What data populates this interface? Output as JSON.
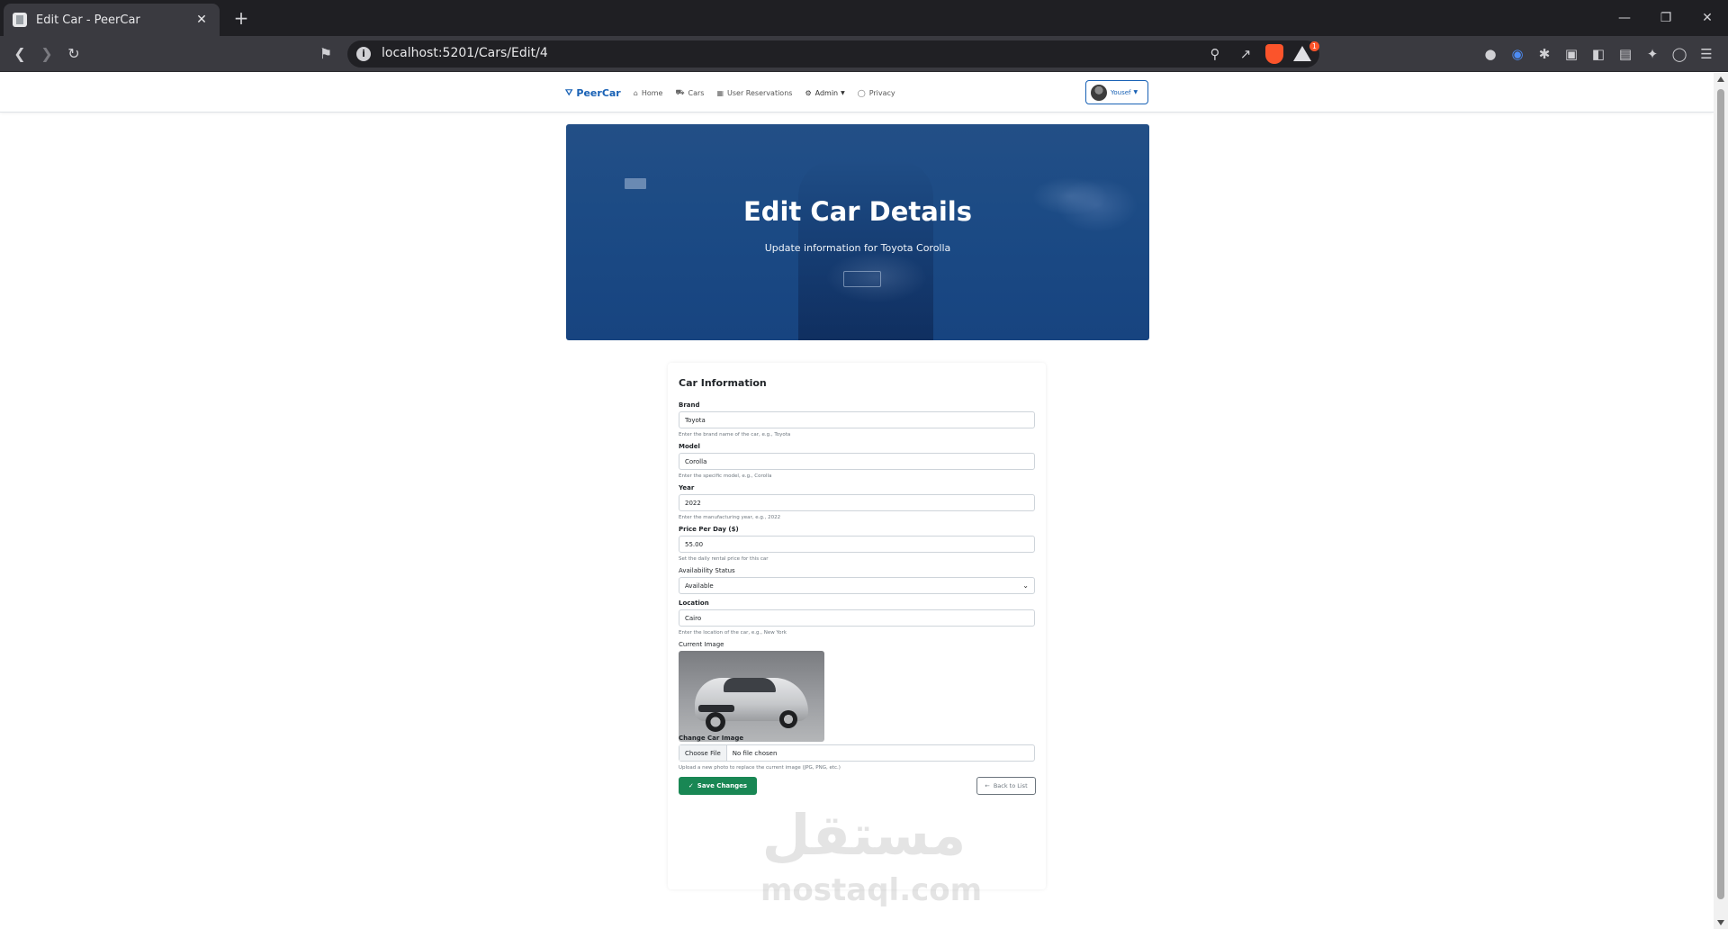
{
  "browser": {
    "tab_title": "Edit Car - PeerCar",
    "tab_close": "✕",
    "new_tab": "+",
    "url": "localhost:5201/Cars/Edit/4",
    "rewards_badge": "1"
  },
  "nav": {
    "brand": "PeerCar",
    "links": {
      "home": "Home",
      "cars": "Cars",
      "reservations": "User Reservations",
      "admin": "Admin",
      "privacy": "Privacy"
    },
    "user": "Yousef"
  },
  "hero": {
    "title": "Edit Car Details",
    "subtitle": "Update information for Toyota Corolla"
  },
  "form": {
    "title": "Car Information",
    "brand": {
      "label": "Brand",
      "value": "Toyota",
      "help": "Enter the brand name of the car, e.g., Toyota"
    },
    "model": {
      "label": "Model",
      "value": "Corolla",
      "help": "Enter the specific model, e.g., Corolla"
    },
    "year": {
      "label": "Year",
      "value": "2022",
      "help": "Enter the manufacturing year, e.g., 2022"
    },
    "price": {
      "label": "Price Per Day ($)",
      "value": "55.00",
      "help": "Set the daily rental price for this car"
    },
    "availability": {
      "label": "Availability Status",
      "value": "Available"
    },
    "location": {
      "label": "Location",
      "value": "Cairo",
      "help": "Enter the location of the car, e.g., New York"
    },
    "current_image_label": "Current Image",
    "change_image": {
      "label": "Change Car Image",
      "button": "Choose File",
      "status": "No file chosen",
      "help": "Upload a new photo to replace the current image (JPG, PNG, etc.)"
    },
    "save_button": "Save Changes",
    "back_button": "Back to List"
  },
  "watermark": {
    "arabic": "مستقل",
    "latin": "mostaql.com"
  },
  "colors": {
    "primary": "#1861b5",
    "hero": "#1c4b85",
    "success": "#198754",
    "secondary": "#6c757d"
  }
}
